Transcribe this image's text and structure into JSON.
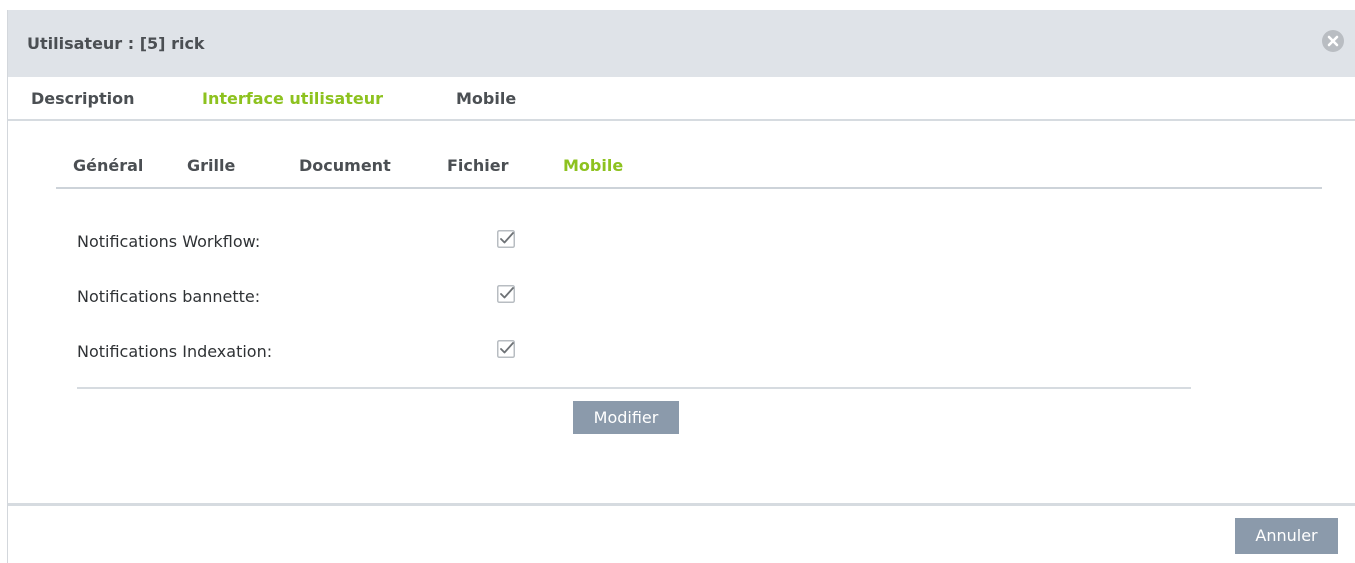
{
  "dialog": {
    "title": "Utilisateur : [5] rick",
    "close_icon": "close-circle-icon"
  },
  "tabs": [
    {
      "label": "Description",
      "active": false
    },
    {
      "label": "Interface utilisateur",
      "active": true
    },
    {
      "label": "Mobile",
      "active": false
    }
  ],
  "subtabs": [
    {
      "label": "Général",
      "active": false
    },
    {
      "label": "Grille",
      "active": false
    },
    {
      "label": "Document",
      "active": false
    },
    {
      "label": "Fichier",
      "active": false
    },
    {
      "label": "Mobile",
      "active": true
    }
  ],
  "settings": [
    {
      "label": "Notifications Workflow:",
      "checked": true
    },
    {
      "label": "Notifications bannette:",
      "checked": true
    },
    {
      "label": "Notifications Indexation:",
      "checked": true
    }
  ],
  "buttons": {
    "modify": "Modifier",
    "cancel": "Annuler"
  },
  "colors": {
    "accent": "#8dc21f",
    "button": "#8b9aab",
    "titlebar": "#dfe3e8"
  }
}
